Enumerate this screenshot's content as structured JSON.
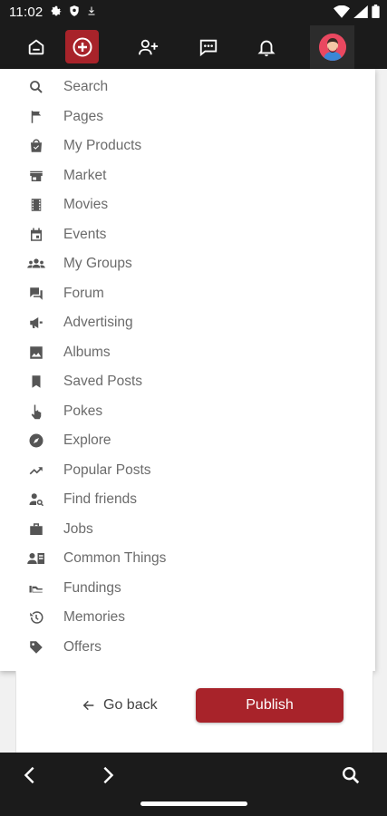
{
  "status_bar": {
    "time": "11:02"
  },
  "menu": {
    "items": [
      {
        "label": "Search",
        "icon": "search-icon"
      },
      {
        "label": "Pages",
        "icon": "flag-icon"
      },
      {
        "label": "My Products",
        "icon": "shopping-bag-icon"
      },
      {
        "label": "Market",
        "icon": "store-icon"
      },
      {
        "label": "Movies",
        "icon": "film-icon"
      },
      {
        "label": "Events",
        "icon": "calendar-icon"
      },
      {
        "label": "My Groups",
        "icon": "groups-icon"
      },
      {
        "label": "Forum",
        "icon": "forum-icon"
      },
      {
        "label": "Advertising",
        "icon": "megaphone-icon"
      },
      {
        "label": "Albums",
        "icon": "image-icon"
      },
      {
        "label": "Saved Posts",
        "icon": "bookmark-icon"
      },
      {
        "label": "Pokes",
        "icon": "hand-pointer-icon"
      },
      {
        "label": "Explore",
        "icon": "compass-icon"
      },
      {
        "label": "Popular Posts",
        "icon": "trending-icon"
      },
      {
        "label": "Find friends",
        "icon": "person-search-icon"
      },
      {
        "label": "Jobs",
        "icon": "briefcase-icon"
      },
      {
        "label": "Common Things",
        "icon": "contact-card-icon"
      },
      {
        "label": "Fundings",
        "icon": "funding-icon"
      },
      {
        "label": "Memories",
        "icon": "history-icon"
      },
      {
        "label": "Offers",
        "icon": "tag-icon"
      }
    ]
  },
  "actions": {
    "go_back": "Go back",
    "publish": "Publish"
  },
  "colors": {
    "brand": "#a8232a",
    "bar": "#1b1b1b",
    "menu_text": "#6b6b6b"
  }
}
